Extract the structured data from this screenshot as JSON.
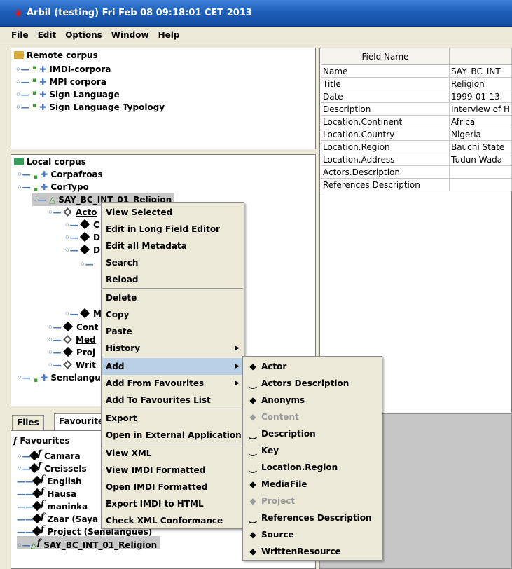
{
  "window": {
    "title": "Arbil (testing) Fri Feb 08 09:18:01 CET 2013"
  },
  "menubar": {
    "items": [
      "File",
      "Edit",
      "Options",
      "Window",
      "Help"
    ]
  },
  "remote_tree": {
    "root": "Remote corpus",
    "items": [
      "IMDI-corpora",
      "MPI corpora",
      "Sign Language",
      "Sign Language Typology"
    ]
  },
  "local_tree": {
    "root": "Local corpus",
    "items": {
      "corpafroas": "Corpafroas",
      "cortypo": "CorTypo",
      "session": "SAY_BC_INT_01_Religion",
      "actors": "Acto",
      "child1": "C",
      "child2": "D",
      "child3": "D",
      "child4": "M",
      "cont": "Cont",
      "med": "Med",
      "proj": "Proj",
      "writ": "Writ",
      "senelangues": "Senelangue"
    }
  },
  "tabs": [
    "Files",
    "Favourite"
  ],
  "favourites": {
    "root": "Favourites",
    "items": [
      "Camara",
      "Creissels",
      "English",
      "Hausa",
      "maninka",
      "Zaar (Saya",
      "Project (Senelangues)",
      "SAY_BC_INT_01_Religion"
    ]
  },
  "table": {
    "header": "Field Name",
    "rows": [
      {
        "field": "Name",
        "value": "SAY_BC_INT"
      },
      {
        "field": "Title",
        "value": "Religion"
      },
      {
        "field": "Date",
        "value": "1999-01-13"
      },
      {
        "field": "Description",
        "value": "Interview of H"
      },
      {
        "field": "Location.Continent",
        "value": "Africa"
      },
      {
        "field": "Location.Country",
        "value": "Nigeria"
      },
      {
        "field": "Location.Region",
        "value": "Bauchi State"
      },
      {
        "field": "Location.Address",
        "value": "Tudun Wada"
      },
      {
        "field": "Actors.Description",
        "value": ""
      },
      {
        "field": "References.Description",
        "value": ""
      }
    ]
  },
  "context_menu": {
    "items": [
      "View Selected",
      "Edit in Long Field Editor",
      "Edit all Metadata",
      "Search",
      "Reload",
      "Delete",
      "Copy",
      "Paste",
      "History",
      "Add",
      "Add From Favourites",
      "Add To Favourites List",
      "Export",
      "Open in External Application",
      "View XML",
      "View IMDI Formatted",
      "Open IMDI Formatted",
      "Export IMDI to HTML",
      "Check XML Conformance"
    ]
  },
  "add_submenu": {
    "items": [
      {
        "label": "Actor",
        "icon": "diamond"
      },
      {
        "label": "Actors Description",
        "icon": "field"
      },
      {
        "label": "Anonyms",
        "icon": "diamond"
      },
      {
        "label": "Content",
        "icon": "diamond-disabled"
      },
      {
        "label": "Description",
        "icon": "field"
      },
      {
        "label": "Key",
        "icon": "field"
      },
      {
        "label": "Location.Region",
        "icon": "field"
      },
      {
        "label": "MediaFile",
        "icon": "diamond"
      },
      {
        "label": "Project",
        "icon": "diamond-disabled"
      },
      {
        "label": "References Description",
        "icon": "field"
      },
      {
        "label": "Source",
        "icon": "diamond"
      },
      {
        "label": "WrittenResource",
        "icon": "diamond"
      }
    ]
  }
}
